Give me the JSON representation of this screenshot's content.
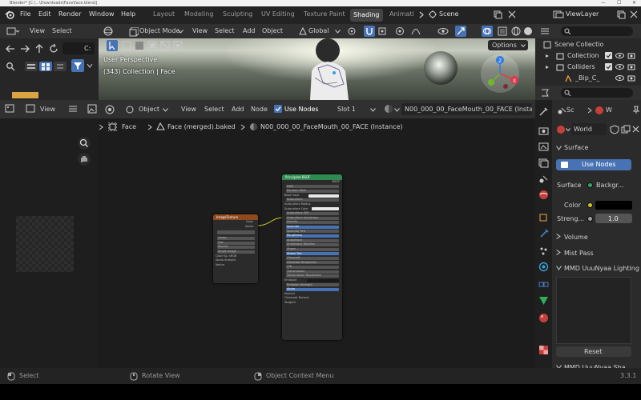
{
  "window": {
    "title": "Blender* [C:\\...\\Downloads\\Face\\face.blend]",
    "minimize": "—",
    "maximize": "☐",
    "close": "✕"
  },
  "menu": {
    "file": "File",
    "edit": "Edit",
    "render": "Render",
    "window": "Window",
    "help": "Help"
  },
  "workspaces": [
    "Layout",
    "Modeling",
    "Sculpting",
    "UV Editing",
    "Texture Paint",
    "Shading",
    "Animati"
  ],
  "active_workspace": "Shading",
  "scene": {
    "scene_name": "Scene",
    "view_layer": "ViewLayer"
  },
  "filebrowser": {
    "view": "View",
    "select": "Select",
    "path_fragment": "C:"
  },
  "viewport": {
    "mode": "Object Mode",
    "view": "View",
    "select": "Select",
    "add": "Add",
    "object": "Object",
    "orientation": "Global",
    "options": "Options",
    "perspective": "User Perspective",
    "collection_info": "(343) Collection | Face"
  },
  "outliner": {
    "title": "Scene Collectio",
    "items": [
      "Collection",
      "Colliders",
      "_Bip_C_"
    ]
  },
  "node_editor": {
    "object_menu": "Object",
    "view": "View",
    "select": "Select",
    "add": "Add",
    "node": "Node",
    "use_nodes": "Use Nodes",
    "slot": "Slot 1",
    "material": "N00_000_00_FaceMouth_00_FACE (Instance)",
    "breadcrumb": [
      "Face",
      "Face (merged).baked",
      "N00_000_00_FaceMouth_00_FACE (Instance)"
    ],
    "image_node": {
      "title": "ImageTexture",
      "outputs": [
        "Color",
        "Alpha"
      ],
      "fields": [
        "Linear",
        "Flat",
        "Repeat",
        "Single Image",
        "Color Sp.",
        "Alpha",
        "Vector"
      ],
      "values": [
        "sRGB",
        "Straight"
      ]
    },
    "bsdf_node": {
      "title": "Principled BSDF",
      "rows": [
        "BSDF",
        "GGX",
        "Random Walk",
        "Base Color",
        "Subsurface",
        "Subsurface Radius",
        "Subsurface Color",
        "Subsurface IOR",
        "Subsurface Anisotropy",
        "Metallic",
        "Specular",
        "Specular Tint",
        "Roughness",
        "Anisotropic",
        "Anisotropic Rotation",
        "Sheen",
        "Sheen Tint",
        "Clearcoat",
        "Clearcoat Roughness",
        "IOR",
        "Transmission",
        "Transmission Roughness",
        "Emission",
        "Emission Strength",
        "Alpha",
        "Normal",
        "Clearcoat Normal",
        "Tangent"
      ]
    }
  },
  "properties": {
    "tabs": [
      "Sc",
      "W"
    ],
    "world_name": "World",
    "surface": "Surface",
    "use_nodes": "Use Nodes",
    "surface_label": "Surface",
    "surface_value": "Backgr...",
    "color_label": "Color",
    "strength_label": "Streng...",
    "strength_value": "1.0",
    "volume": "Volume",
    "mist_pass": "Mist Pass",
    "mmd_lighting": "MMD UuuNyaa Lighting",
    "reset": "Reset",
    "mmd_shadow": "MMD UuuNyaa Sha"
  },
  "statusbar": {
    "select": "Select",
    "rotate": "Rotate View",
    "context": "Object Context Menu",
    "version": "3.3.1"
  },
  "colors": {
    "accent": "#4772b3",
    "bg": "#1d1d1d",
    "header": "#303030"
  }
}
